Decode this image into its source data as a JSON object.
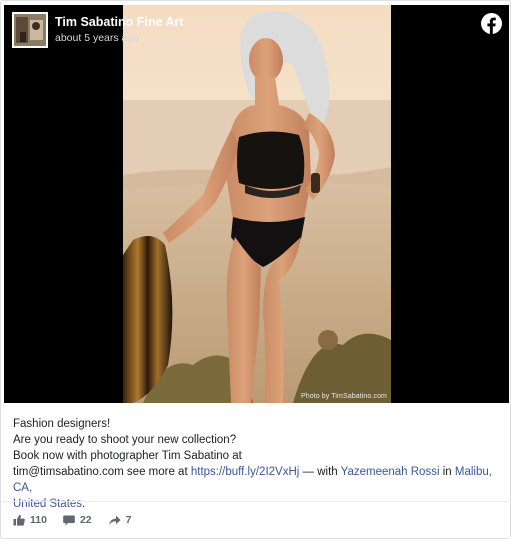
{
  "post": {
    "page_name": "Tim Sabatino Fine Art",
    "timestamp": "about 5 years ago",
    "photo_credit": "Photo by TimSabatino.com",
    "caption": {
      "line1": "Fashion designers!",
      "line2": "Are you ready to shoot your new collection?",
      "line3": "Book now with photographer Tim Sabatino at",
      "line4_prefix": "tim@timsabatino.com see more at ",
      "link_url": "https://buff.ly/2I2VxHj",
      "with_text": " — with ",
      "tagged_person": "Yazemeenah Rossi",
      "in_text": " in ",
      "location_city": "Malibu, CA,",
      "location_country": "United States",
      "end_text": "."
    },
    "stats": {
      "likes": "110",
      "comments": "22",
      "shares": "7"
    }
  },
  "icons": {
    "brand": "facebook-icon",
    "like": "thumbs-up-icon",
    "comment": "comment-icon",
    "share": "share-arrow-icon"
  },
  "colors": {
    "link": "#385898",
    "facebook_brand": "#ffffff",
    "meta_text": "#606770"
  }
}
